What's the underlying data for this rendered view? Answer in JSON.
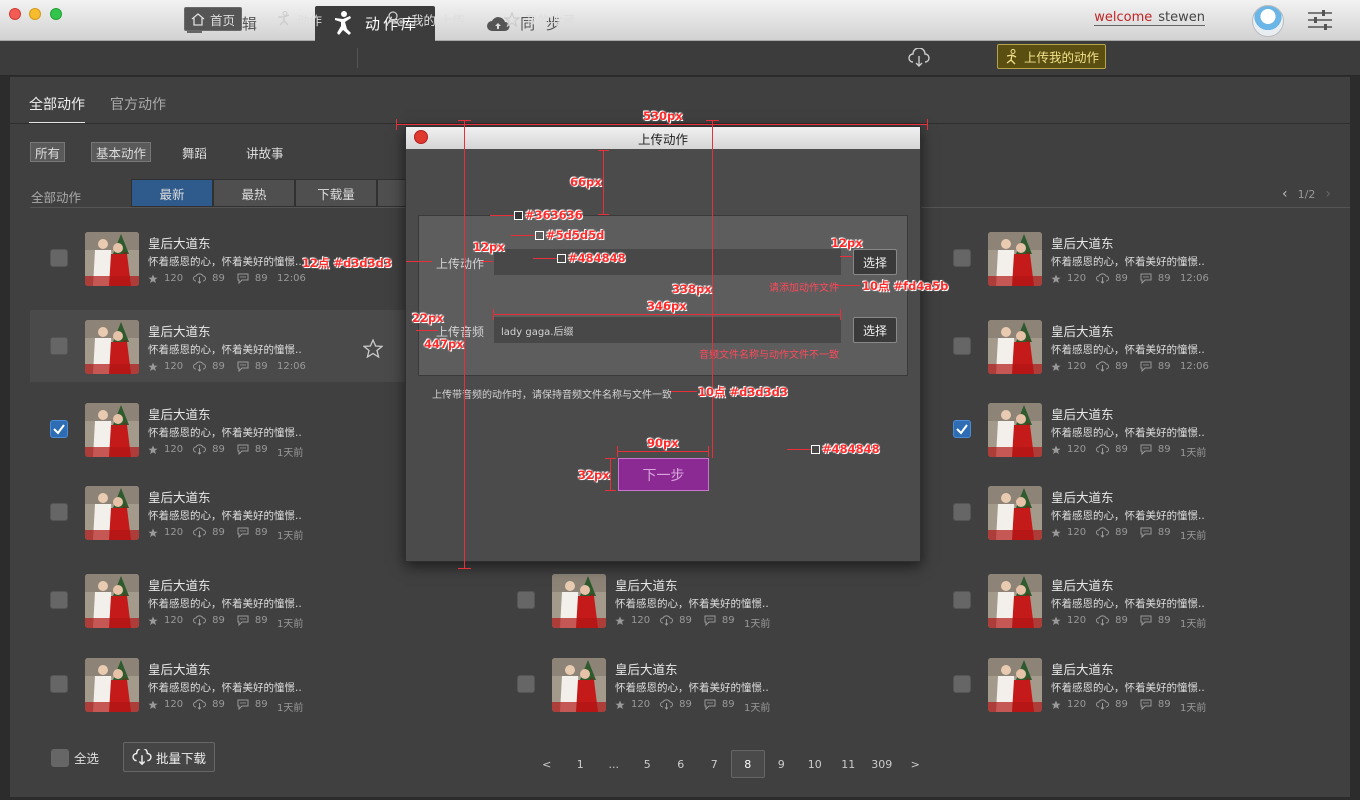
{
  "titlebar": {
    "tabs": [
      {
        "label": "编 辑",
        "icon": "edit-icon"
      },
      {
        "label": "动作库",
        "icon": "dancer-icon"
      },
      {
        "label": "同 步",
        "icon": "cloud-icon"
      }
    ],
    "welcome_word": "welcome",
    "username": "stewen"
  },
  "subbar": {
    "items": [
      {
        "label": "首页",
        "icon": "home-icon"
      },
      {
        "label": "动作",
        "icon": "action-icon"
      },
      {
        "label": "我的 上传",
        "icon": "user-upload-icon"
      },
      {
        "label": "我的收藏",
        "icon": "star-icon"
      }
    ],
    "upload_mine": "上传我的动作"
  },
  "main": {
    "top_tabs": [
      "全部动作",
      "官方动作"
    ],
    "filters": [
      "所有",
      "基本动作",
      "舞蹈",
      "讲故事"
    ],
    "list_label": "全部动作",
    "sort_tabs": [
      "最新",
      "最热",
      "下载量"
    ],
    "page_indicator": "1/2"
  },
  "items": {
    "title": "皇后大道东",
    "desc": "怀着感恩的心，怀着美好的憧憬..",
    "likes": "120",
    "downloads": "89",
    "comments": "89",
    "time_a": "12:06",
    "time_b": "1天前"
  },
  "bottom": {
    "select_all": "全选",
    "batch_download": "批量下载",
    "pages": [
      "<",
      "1",
      "...",
      "5",
      "6",
      "7",
      "8",
      "9",
      "10",
      "11",
      "309",
      ">"
    ],
    "current_page": "8"
  },
  "dialog": {
    "title": "上传动作",
    "upload_action_label": "上传动作",
    "upload_audio_label": "上传音频",
    "audio_value": "lady gaga.后缀",
    "choose": "选择",
    "err_action": "请添加动作文件",
    "err_audio": "音频文件名称与动作文件不一致",
    "hint": "上传带音频的动作时，请保持音频文件名称与文件一致",
    "next": "下一步"
  },
  "annotations": {
    "w530": "530px",
    "h66": "66px",
    "c363636": "#363636",
    "c5d5d5d": "#5d5d5d",
    "c484848a": "#484848",
    "pt12": "12点 #d3d3d3",
    "px12a": "12px",
    "px12b": "12px",
    "px338": "338px",
    "pt10err": "10点 #fd4a5b",
    "px346": "346px",
    "px22": "22px",
    "px447": "447px",
    "pt10hint": "10点 #d3d3d3",
    "px90": "90px",
    "px32": "32px",
    "c484848b": "#484848"
  },
  "colors": {
    "accent_blue": "#2f5a8c",
    "next_purple": "#8c2a93",
    "error": "#fd4a5b",
    "annotation": "#ff2a2a"
  }
}
